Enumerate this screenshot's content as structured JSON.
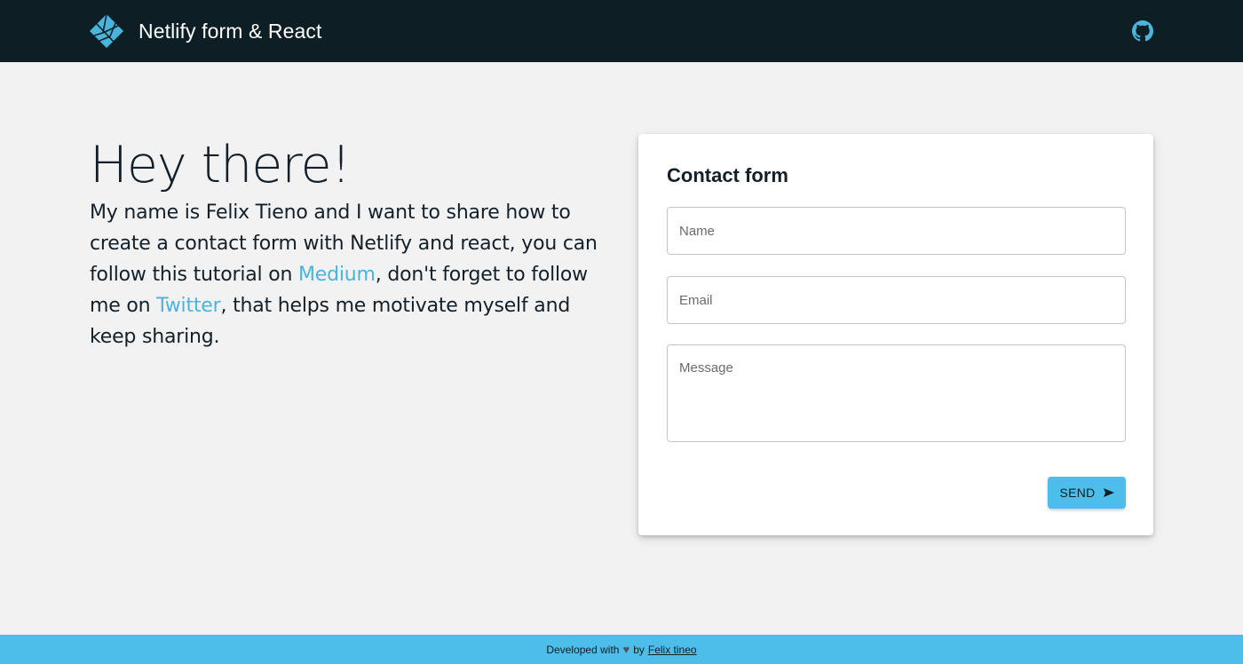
{
  "header": {
    "title": "Netlify form & React",
    "logo_icon": "netlify-logo-icon",
    "github_icon": "github-icon",
    "background": "#0e1e25"
  },
  "intro": {
    "heading": "Hey there!",
    "text_1": "My name is Felix Tieno and I want to share how to create a contact form with Netlify and react, you can follow this tutorial on ",
    "link_medium": "Medium",
    "text_2": ", don't forget to follow me on ",
    "link_twitter": "Twitter",
    "text_3": ", that helps me motivate myself and keep sharing."
  },
  "form": {
    "title": "Contact form",
    "name_placeholder": "Name",
    "name_value": "",
    "email_placeholder": "Email",
    "email_value": "",
    "message_placeholder": "Message",
    "message_value": "",
    "send_label": "SEND",
    "send_icon": "send-icon"
  },
  "footer": {
    "text": "Developed with",
    "heart_icon": "heart-icon",
    "by": "by",
    "author_link": "Felix tineo",
    "background": "#4dbde9"
  },
  "colors": {
    "accent": "#4dbde9",
    "link": "#4ab4dd",
    "text": "#13202a",
    "page_bg": "#f2f2f2"
  }
}
